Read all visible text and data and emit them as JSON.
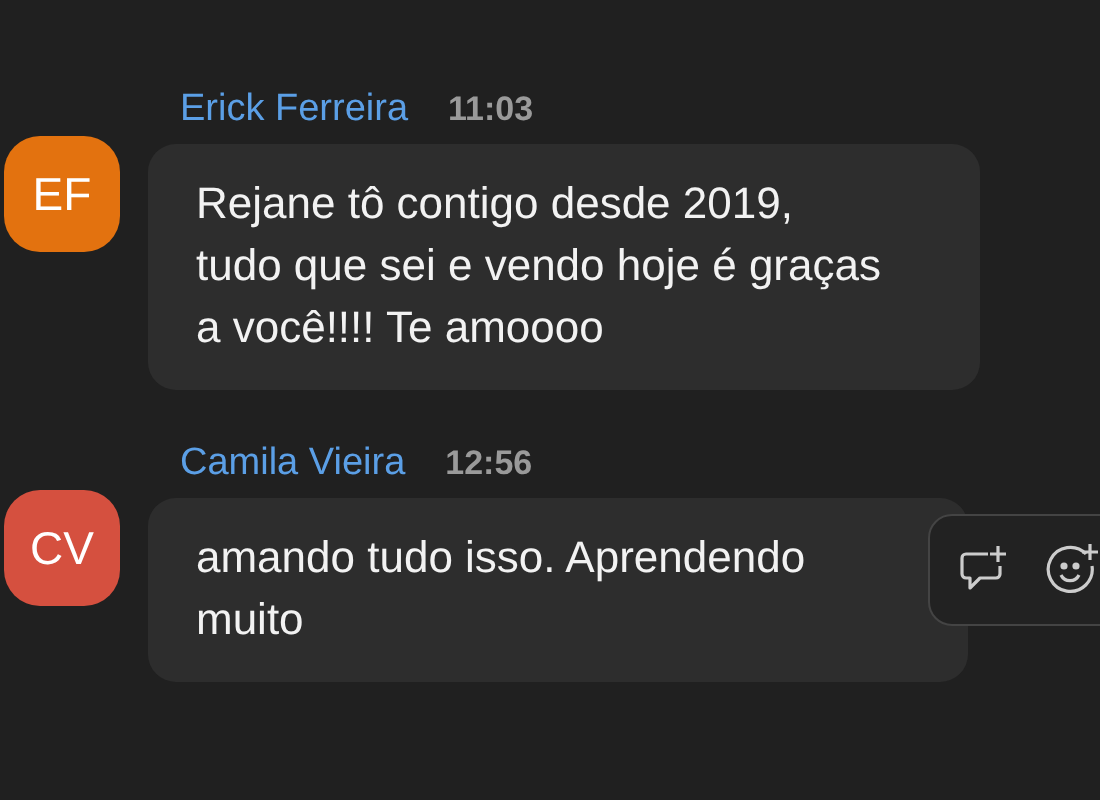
{
  "messages": [
    {
      "author": "Erick Ferreira",
      "time": "11:03",
      "initials": "EF",
      "color": "#e3720f",
      "text": "Rejane tô contigo desde 2019, tudo que sei e vendo hoje é graças a você!!!! Te amoooo",
      "hovered": false
    },
    {
      "author": "Camila Vieira",
      "time": "12:56",
      "initials": "CV",
      "color": "#d5503f",
      "text": "amando tudo isso. Aprendendo muito",
      "hovered": true
    }
  ]
}
